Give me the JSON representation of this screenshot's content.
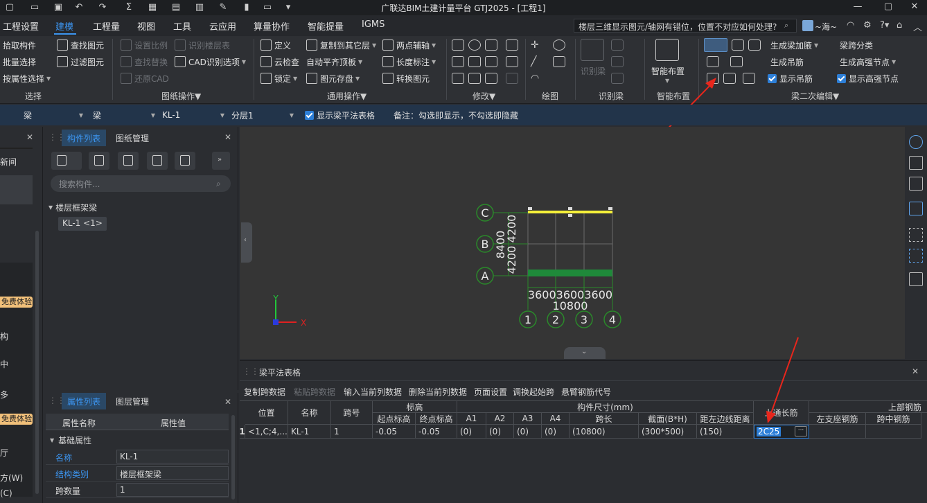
{
  "app_title": "广联达BIM土建计量平台 GTJ2025 - [工程1]",
  "menu": [
    "工程设置",
    "建模",
    "工程量",
    "视图",
    "工具",
    "云应用",
    "算量协作",
    "智能提量",
    "IGMS"
  ],
  "menu_active": "建模",
  "search_value": "楼层三维显示图元/轴网有错位，位置不对应如何处理?",
  "user": "~海~",
  "ribbon": {
    "select": {
      "items": [
        "拾取构件",
        "批量选择",
        "按属性选择"
      ],
      "find": "查找图元",
      "filter": "过滤图元",
      "label": "选择"
    },
    "drawing_ops": {
      "set_scale": "设置比例",
      "find_replace": "查找替换",
      "restore_cad": "还原CAD",
      "recognize_floor": "识别楼层表",
      "cad_options": "CAD识别选项",
      "label": "图纸操作"
    },
    "general_ops": {
      "define": "定义",
      "cloud_check": "云检查",
      "lock": "锁定",
      "copy_floor": "复制到其它层",
      "auto_align": "自动平齐顶板",
      "save_elem": "图元存盘",
      "two_point_axis": "两点辅轴",
      "length_dim": "长度标注",
      "convert": "转换图元",
      "label": "通用操作"
    },
    "modify_label": "修改",
    "draw_label": "绘图",
    "recognize_beam": {
      "btn": "识别梁",
      "label": "识别梁"
    },
    "smart_layout": {
      "btn": "智能布置",
      "label": "智能布置"
    },
    "beam_edit": {
      "gen_haunch": "生成梁加腋",
      "gen_hanger": "生成吊筋",
      "show_hanger": "显示吊筋",
      "span_class": "梁跨分类",
      "gen_node": "生成高强节点",
      "show_node": "显示高强节点",
      "label": "梁二次编辑"
    }
  },
  "toolbar2": {
    "sel1": "梁",
    "sel2": "梁",
    "sel3": "KL-1",
    "sel4": "分层1",
    "show_table": "显示梁平法表格",
    "note": "备注：勾选即显示，不勾选即隐藏"
  },
  "left_strip": {
    "items": [
      "新间",
      "构",
      "中",
      "多",
      "方(W)",
      "(C)",
      "厅"
    ],
    "badge": "免费体验"
  },
  "comp_panel": {
    "tabs": [
      "构件列表",
      "图纸管理"
    ],
    "search_placeholder": "搜索构件...",
    "tree_root": "楼层框架梁",
    "tree_item": "KL-1 <1>"
  },
  "prop_panel": {
    "tabs": [
      "属性列表",
      "图层管理"
    ],
    "headers": [
      "属性名称",
      "属性值"
    ],
    "section": "基础属性",
    "rows": [
      {
        "name": "名称",
        "value": "KL-1"
      },
      {
        "name": "结构类别",
        "value": "楼层框架梁"
      },
      {
        "name": "跨数量",
        "value": "1"
      }
    ]
  },
  "viewport": {
    "axis_rows": [
      "C",
      "B",
      "A"
    ],
    "axis_cols": [
      "1",
      "2",
      "3",
      "4"
    ],
    "dim_vertical": [
      "8400",
      "4200",
      "4200"
    ],
    "dim_bottom": "360036003600",
    "dim_total": "10800",
    "axis_x": "X",
    "axis_y": "Y"
  },
  "table_panel": {
    "title": "梁平法表格",
    "toolbar": [
      "复制跨数据",
      "粘贴跨数据",
      "输入当前列数据",
      "删除当前列数据",
      "页面设置",
      "调换起始跨",
      "悬臂钢筋代号"
    ],
    "headers": {
      "pos": "位置",
      "name": "名称",
      "span": "跨号",
      "elev": "标高",
      "elev_start": "起点标高",
      "elev_end": "终点标高",
      "size": "构件尺寸(mm)",
      "a1": "A1",
      "a2": "A2",
      "a3": "A3",
      "a4": "A4",
      "span_len": "跨长",
      "section": "截面(B*H)",
      "dist": "距左边线距离",
      "top_long": "上通长筋",
      "top_rebar": "上部钢筋",
      "left_support": "左支座钢筋",
      "mid_span": "跨中钢筋"
    },
    "row": {
      "idx": "1",
      "pos": "<1,C;4,...",
      "name": "KL-1",
      "span": "1",
      "elev_start": "-0.05",
      "elev_end": "-0.05",
      "a1": "(0)",
      "a2": "(0)",
      "a3": "(0)",
      "a4": "(0)",
      "span_len": "(10800)",
      "section": "(300*500)",
      "dist": "(150)",
      "top_long": "2C25"
    }
  }
}
